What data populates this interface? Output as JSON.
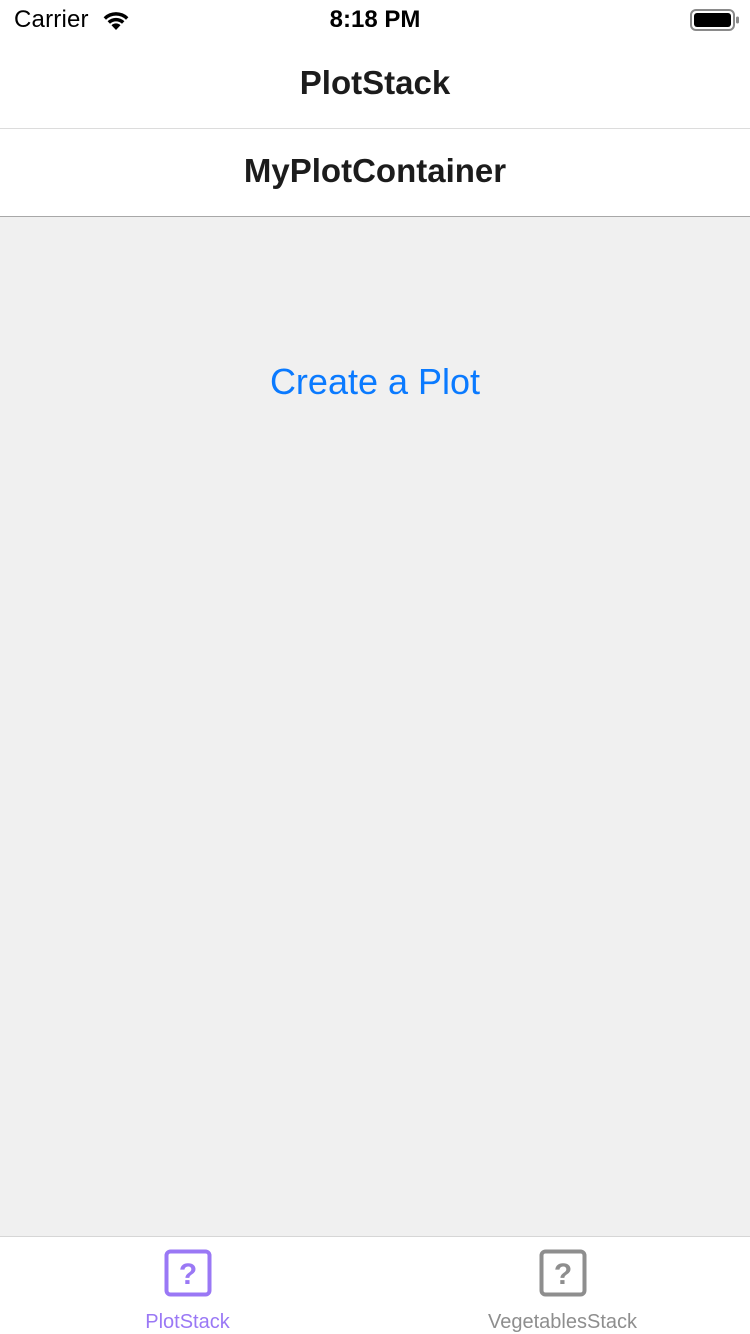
{
  "status_bar": {
    "carrier": "Carrier",
    "time": "8:18 PM",
    "wifi_icon": "wifi-icon",
    "battery_icon": "battery-icon"
  },
  "nav_outer": {
    "title": "PlotStack"
  },
  "nav_inner": {
    "title": "MyPlotContainer"
  },
  "content": {
    "create_button_label": "Create a Plot"
  },
  "tab_bar": {
    "tabs": [
      {
        "label": "PlotStack",
        "icon": "question-square-icon",
        "selected": true,
        "color": "#9a78f5"
      },
      {
        "label": "VegetablesStack",
        "icon": "question-square-icon",
        "selected": false,
        "color": "#8e8e8e"
      }
    ]
  },
  "colors": {
    "accent": "#0a7aff",
    "background": "#f0f0f0",
    "selected_tab": "#9a78f5",
    "unselected_tab": "#8e8e8e"
  }
}
